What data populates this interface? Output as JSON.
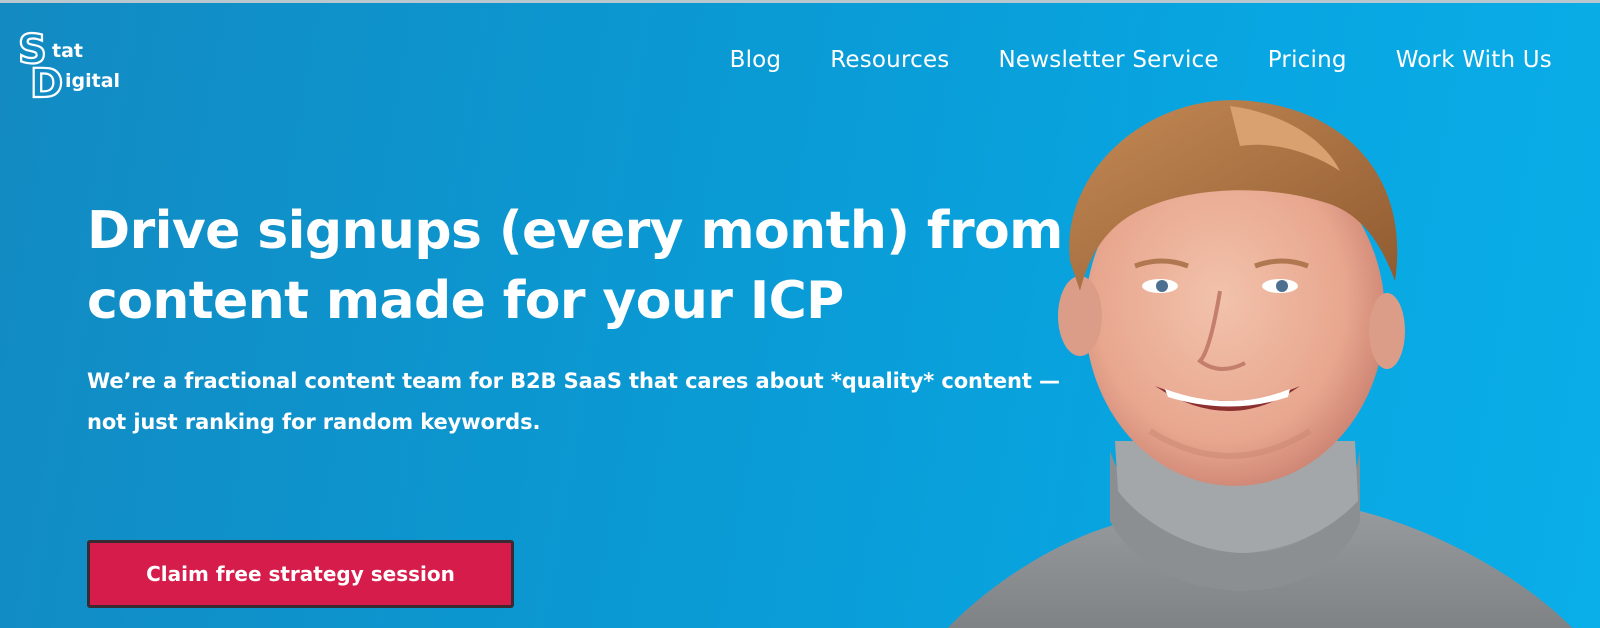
{
  "logo": {
    "letter_s": "S",
    "letter_d": "D",
    "word1": "tat",
    "word2": "igital"
  },
  "nav": {
    "items": [
      {
        "label": "Blog"
      },
      {
        "label": "Resources"
      },
      {
        "label": "Newsletter Service"
      },
      {
        "label": "Pricing"
      },
      {
        "label": "Work With Us"
      }
    ]
  },
  "hero": {
    "headline_line1": "Drive signups (every month) from",
    "headline_line2": "content made for your ICP",
    "subline_line1": "We’re a fractional content team for B2B SaaS that cares about *quality* content —",
    "subline_line2": "not just ranking for random keywords.",
    "cta_label": "Claim free strategy session"
  },
  "colors": {
    "background": "#0a9ad4",
    "cta": "#d51c4a",
    "text": "#ffffff"
  }
}
